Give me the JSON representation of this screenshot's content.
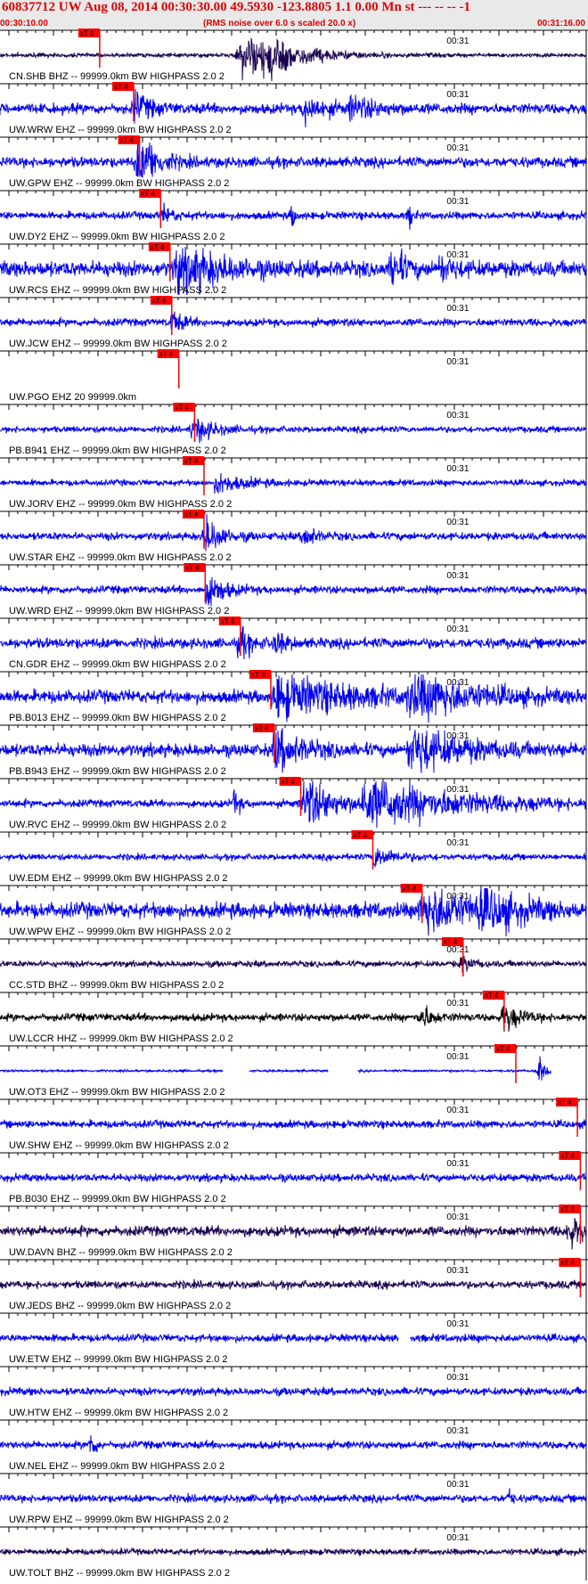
{
  "header": {
    "title": "60837712 UW Aug 08, 2014 00:30:30.00   49.5930 -123.8805  1.1 0.00 Mn st --- -- --   -1",
    "start_time": "00:30:10.00",
    "scale_note": "(RMS noise over 6.0 s scaled 20.0 x)",
    "end_time": "00:31:16.00"
  },
  "colors": {
    "trace": "#0000ee",
    "trace_dark": "#1a0050",
    "trace_black": "#000000",
    "pick": "#ff0000",
    "header_text": "#e00000",
    "header_bg": "#e9e9e9"
  },
  "chart_data": {
    "type": "seismogram",
    "time_range": [
      "00:30:10.00",
      "00:31:16.00"
    ],
    "tick_mark_label": "00:31",
    "pick_label": "xT 4",
    "traces": [
      {
        "label": "CN.SHB BHZ -- 99999.0km BW  HIGHPASS  2.0  2",
        "color": "dark",
        "pick": 0.17,
        "amp": 0.08,
        "events": [
          [
            0.41,
            0.08,
            0.9
          ],
          [
            0.45,
            0.06,
            0.6
          ]
        ]
      },
      {
        "label": "UW.WRW EHZ -- 99999.0km BW  HIGHPASS  2.0  2",
        "color": "blue",
        "pick": 0.228,
        "amp": 0.2,
        "events": [
          [
            0.23,
            0.03,
            0.55
          ],
          [
            0.52,
            0.04,
            0.5
          ],
          [
            0.6,
            0.05,
            0.4
          ]
        ]
      },
      {
        "label": "UW.GPW EHZ -- 99999.0km BW  HIGHPASS  2.0  2",
        "color": "blue",
        "pick": 0.238,
        "amp": 0.2,
        "events": [
          [
            0.235,
            0.03,
            0.75
          ],
          [
            0.25,
            0.03,
            0.5
          ]
        ]
      },
      {
        "label": "UW.DY2 EHZ -- 99999.0km BW  HIGHPASS  2.0  2",
        "color": "blue",
        "pick": 0.274,
        "amp": 0.15,
        "events": [
          [
            0.28,
            0.02,
            0.3
          ],
          [
            0.5,
            0.005,
            0.4
          ],
          [
            0.7,
            0.005,
            0.4
          ]
        ]
      },
      {
        "label": "UW.RCS EHZ -- 99999.0km BW  HIGHPASS  2.0  2",
        "color": "blue",
        "pick": 0.29,
        "amp": 0.3,
        "events": [
          [
            0.3,
            0.08,
            0.95
          ],
          [
            0.67,
            0.02,
            0.9
          ],
          [
            0.75,
            0.03,
            0.4
          ]
        ]
      },
      {
        "label": "UW.JCW EHZ -- 99999.0km BW  HIGHPASS  2.0  2",
        "color": "blue",
        "pick": 0.293,
        "amp": 0.15,
        "events": [
          [
            0.295,
            0.02,
            0.45
          ]
        ]
      },
      {
        "label": "UW.PGO EHZ 20 99999.0km",
        "color": "blue",
        "pick": 0.305,
        "amp": 0.0,
        "events": []
      },
      {
        "label": "PB.B941 EHZ -- 99999.0km BW  HIGHPASS  2.0  2",
        "color": "blue",
        "pick": 0.332,
        "amp": 0.12,
        "events": [
          [
            0.33,
            0.04,
            0.5
          ]
        ]
      },
      {
        "label": "UW.JORV EHZ -- 99999.0km BW  HIGHPASS  2.0  2",
        "color": "blue",
        "pick": 0.348,
        "amp": 0.12,
        "events": [
          [
            0.37,
            0.05,
            0.4
          ]
        ]
      },
      {
        "label": "UW.STAR EHZ -- 99999.0km BW  HIGHPASS  2.0  2",
        "color": "blue",
        "pick": 0.348,
        "amp": 0.15,
        "events": [
          [
            0.35,
            0.03,
            0.8
          ],
          [
            0.52,
            0.02,
            0.45
          ]
        ]
      },
      {
        "label": "UW.WRD EHZ -- 99999.0km BW  HIGHPASS  2.0  2",
        "color": "blue",
        "pick": 0.35,
        "amp": 0.15,
        "events": [
          [
            0.355,
            0.03,
            0.7
          ]
        ]
      },
      {
        "label": "CN.GDR EHZ -- 99999.0km BW  HIGHPASS  2.0  2",
        "color": "blue",
        "pick": 0.41,
        "amp": 0.2,
        "events": [
          [
            0.41,
            0.02,
            0.55
          ],
          [
            0.47,
            0.02,
            0.4
          ]
        ]
      },
      {
        "label": "PB.B013 EHZ -- 99999.0km BW  HIGHPASS  2.0  2",
        "color": "blue",
        "pick": 0.462,
        "amp": 0.25,
        "events": [
          [
            0.47,
            0.15,
            0.8
          ],
          [
            0.7,
            0.1,
            0.95
          ]
        ]
      },
      {
        "label": "PB.B943 EHZ -- 99999.0km BW  HIGHPASS  2.0  2",
        "color": "blue",
        "pick": 0.468,
        "amp": 0.25,
        "events": [
          [
            0.47,
            0.05,
            0.75
          ],
          [
            0.7,
            0.09,
            0.95
          ]
        ]
      },
      {
        "label": "UW.RVC EHZ -- 99999.0km BW  HIGHPASS  2.0  2",
        "color": "blue",
        "pick": 0.513,
        "amp": 0.15,
        "events": [
          [
            0.4,
            0.01,
            0.5
          ],
          [
            0.52,
            0.06,
            1.0
          ],
          [
            0.62,
            0.18,
            1.0
          ]
        ]
      },
      {
        "label": "UW.EDM EHZ -- 99999.0km BW  HIGHPASS  2.0  2",
        "color": "blue",
        "pick": 0.636,
        "amp": 0.12,
        "events": [
          [
            0.64,
            0.04,
            0.4
          ]
        ]
      },
      {
        "label": "UW.WPW EHZ -- 99999.0km BW  HIGHPASS  2.0  2",
        "color": "blue",
        "pick": 0.72,
        "amp": 0.3,
        "events": [
          [
            0.72,
            0.1,
            0.95
          ],
          [
            0.82,
            0.06,
            0.7
          ]
        ]
      },
      {
        "label": "CC.STD BHZ -- 99999.0km BW  HIGHPASS  2.0  2",
        "color": "dark",
        "pick": 0.79,
        "amp": 0.12,
        "events": [
          [
            0.79,
            0.02,
            0.3
          ]
        ]
      },
      {
        "label": "UW.LCCR HHZ -- 99999.0km BW  HIGHPASS  2.0  2",
        "color": "black",
        "pick": 0.86,
        "amp": 0.15,
        "events": [
          [
            0.72,
            0.02,
            0.5
          ],
          [
            0.86,
            0.03,
            0.55
          ]
        ]
      },
      {
        "label": "UW.OT3 EHZ -- 99999.0km BW  HIGHPASS  2.0  2",
        "color": "blue",
        "pick": 0.88,
        "amp": 0.04,
        "events": [
          [
            0.92,
            0.01,
            0.6
          ]
        ],
        "gaps": [
          [
            0.38,
            0.425
          ],
          [
            0.56,
            0.61
          ],
          [
            0.94,
            1.0
          ]
        ]
      },
      {
        "label": "UW.SHW EHZ -- 99999.0km BW  HIGHPASS  2.0  2",
        "color": "blue",
        "pick": 0.985,
        "amp": 0.15,
        "events": []
      },
      {
        "label": "PB.B030 EHZ -- 99999.0km BW  HIGHPASS  2.0  2",
        "color": "blue",
        "pick": 0.99,
        "amp": 0.15,
        "events": []
      },
      {
        "label": "UW.DAVN BHZ -- 99999.0km BW  HIGHPASS  2.0  2",
        "color": "dark",
        "pick": 0.99,
        "amp": 0.2,
        "events": [
          [
            0.97,
            0.03,
            0.6
          ]
        ]
      },
      {
        "label": "UW.JEDS BHZ -- 99999.0km BW  HIGHPASS  2.0  2",
        "color": "dark",
        "pick": 0.99,
        "amp": 0.15,
        "events": []
      },
      {
        "label": "UW.ETW EHZ -- 99999.0km BW  HIGHPASS  2.0  2",
        "color": "blue",
        "pick": null,
        "amp": 0.15,
        "events": [],
        "gaps": [
          [
            0.68,
            0.7
          ]
        ]
      },
      {
        "label": "UW.HTW EHZ -- 99999.0km BW  HIGHPASS  2.0  2",
        "color": "blue",
        "pick": null,
        "amp": 0.15,
        "events": []
      },
      {
        "label": "UW.NEL EHZ -- 99999.0km BW  HIGHPASS  2.0  2",
        "color": "blue",
        "pick": null,
        "amp": 0.15,
        "events": [
          [
            0.155,
            0.01,
            0.45
          ]
        ]
      },
      {
        "label": "UW.RPW EHZ -- 99999.0km BW  HIGHPASS  2.0  2",
        "color": "blue",
        "pick": null,
        "amp": 0.15,
        "events": [
          [
            0.87,
            0.005,
            0.35
          ]
        ]
      },
      {
        "label": "UW.TOLT BHZ -- 99999.0km BW  HIGHPASS  2.0  2",
        "color": "dark",
        "pick": null,
        "amp": 0.12,
        "events": []
      }
    ]
  }
}
